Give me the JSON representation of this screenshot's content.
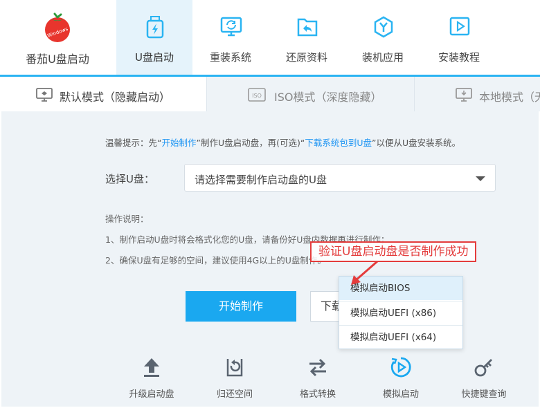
{
  "brand": {
    "name": "番茄U盘启动",
    "logo_text": "Windows",
    "logo_icon": "tomato-logo"
  },
  "nav": [
    {
      "label": "U盘启动",
      "icon": "usb-bolt-icon",
      "active": true
    },
    {
      "label": "重装系统",
      "icon": "monitor-refresh-icon",
      "active": false
    },
    {
      "label": "还原资料",
      "icon": "folder-restore-icon",
      "active": false
    },
    {
      "label": "装机应用",
      "icon": "hexagon-y-icon",
      "active": false
    },
    {
      "label": "安装教程",
      "icon": "video-play-icon",
      "active": false
    }
  ],
  "modes": [
    {
      "label": "默认模式（隐藏启动）",
      "icon": "monitor-icon",
      "active": true
    },
    {
      "label": "ISO模式（深度隐藏）",
      "icon": "iso-icon",
      "active": false
    },
    {
      "label": "本地模式（无",
      "icon": "monitor-download-icon",
      "active": false
    }
  ],
  "tip": {
    "prefix": "温馨提示：先“",
    "link1": "开始制作",
    "middle": "”制作U盘启动盘，再(可选)“",
    "link2": "下载系统包到U盘",
    "suffix": "”以便从U盘安装系统。"
  },
  "select": {
    "label": "选择U盘：",
    "placeholder": "请选择需要制作启动盘的U盘"
  },
  "instructions": {
    "title": "操作说明：",
    "line1": "1、制作启动U盘时将会格式化您的U盘，请备份好U盘内数据再进行制作；",
    "line2": "2、确保U盘有足够的空间，建议使用4G以上的U盘制作。"
  },
  "buttons": {
    "start": "开始制作",
    "download": "下载"
  },
  "tools": [
    {
      "label": "升级启动盘",
      "icon": "upload-arrow-icon"
    },
    {
      "label": "归还空间",
      "icon": "restore-space-icon"
    },
    {
      "label": "格式转换",
      "icon": "swap-arrows-icon"
    },
    {
      "label": "模拟启动",
      "icon": "play-circle-icon"
    },
    {
      "label": "快捷键查询",
      "icon": "key-icon"
    }
  ],
  "popup": [
    {
      "label": "模拟启动BIOS"
    },
    {
      "label": "模拟启动UEFI (x86)"
    },
    {
      "label": "模拟启动UEFI (x64)"
    }
  ],
  "annotation": {
    "text": "验证U盘启动盘是否制作成功"
  },
  "colors": {
    "accent": "#2ab4f2",
    "button": "#1aa8f0",
    "link": "#2196f3",
    "annotation": "#e43c3c",
    "tomato": "#e8352d"
  }
}
